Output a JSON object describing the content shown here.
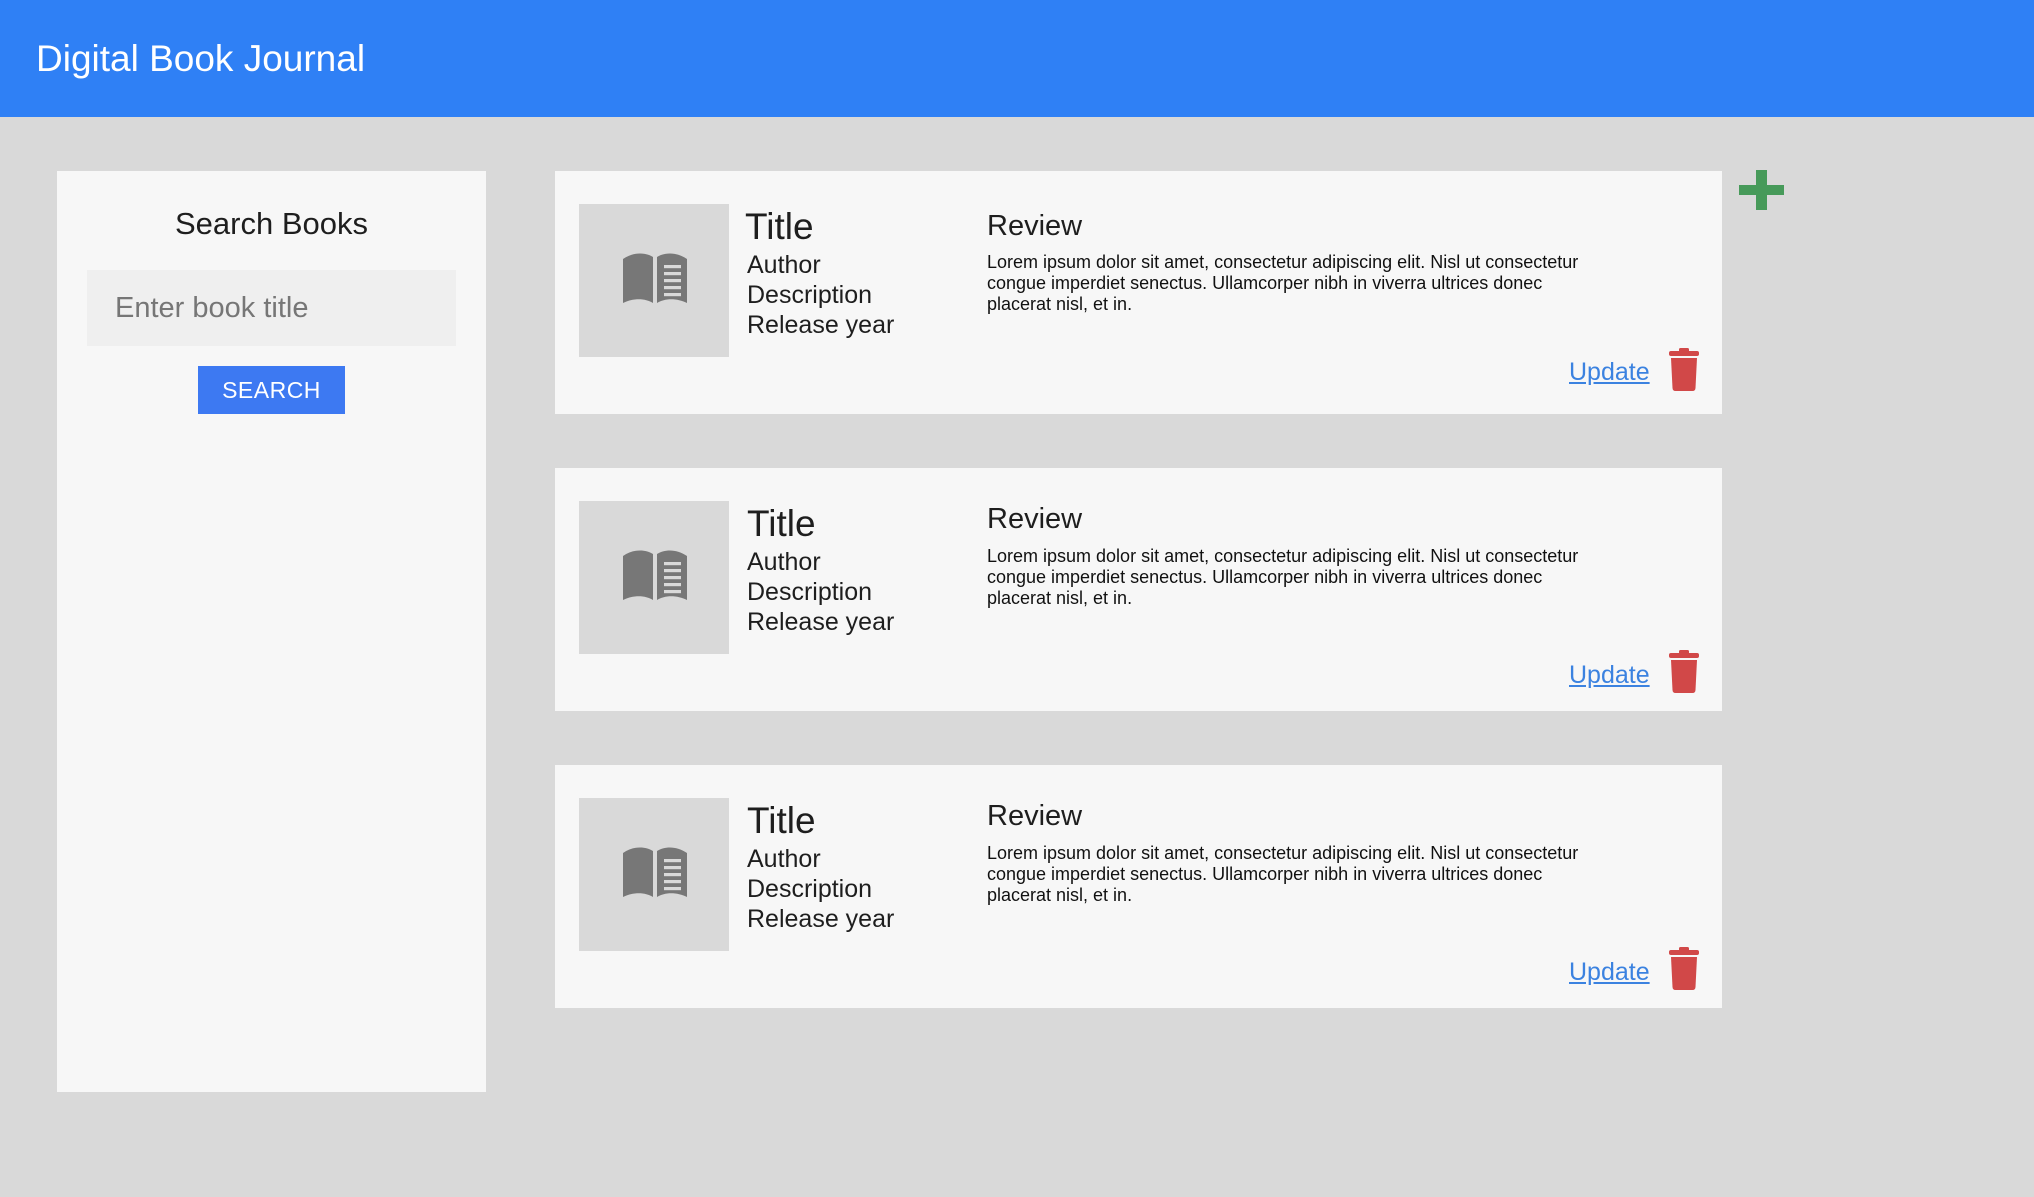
{
  "header": {
    "title": "Digital Book Journal"
  },
  "sidebar": {
    "title": "Search Books",
    "search_placeholder": "Enter book title",
    "search_button_label": "SEARCH"
  },
  "books": [
    {
      "title": "Title",
      "author": "Author",
      "description": "Description",
      "release_year": "Release year",
      "review_heading": "Review",
      "review_text": "Lorem ipsum dolor sit amet, consectetur adipiscing elit. Nisl ut consectetur congue imperdiet senectus. Ullamcorper nibh in viverra ultrices donec placerat nisl, et in.",
      "update_label": "Update"
    },
    {
      "title": "Title",
      "author": "Author",
      "description": "Description",
      "release_year": "Release year",
      "review_heading": "Review",
      "review_text": "Lorem ipsum dolor sit amet, consectetur adipiscing elit. Nisl ut consectetur congue imperdiet senectus. Ullamcorper nibh in viverra ultrices donec placerat nisl, et in.",
      "update_label": "Update"
    },
    {
      "title": "Title",
      "author": "Author",
      "description": "Description",
      "release_year": "Release year",
      "review_heading": "Review",
      "review_text": "Lorem ipsum dolor sit amet, consectetur adipiscing elit. Nisl ut consectetur congue imperdiet senectus. Ullamcorper nibh in viverra ultrices donec placerat nisl, et in.",
      "update_label": "Update"
    }
  ],
  "icons": {
    "book": "book-open-icon",
    "delete": "trash-icon",
    "add": "plus-icon"
  },
  "colors": {
    "header": "#2f80f5",
    "search_button": "#3d79f2",
    "link": "#3b82e0",
    "delete": "#d14848",
    "add": "#479a5a",
    "background": "#d9d9d9",
    "panel": "#f7f7f7"
  }
}
